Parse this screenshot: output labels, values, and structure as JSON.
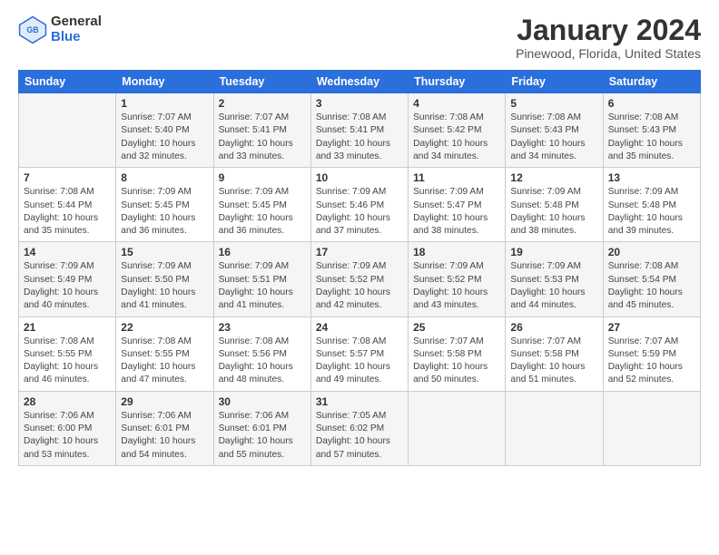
{
  "header": {
    "logo": {
      "general": "General",
      "blue": "Blue"
    },
    "title": "January 2024",
    "location": "Pinewood, Florida, United States"
  },
  "days_of_week": [
    "Sunday",
    "Monday",
    "Tuesday",
    "Wednesday",
    "Thursday",
    "Friday",
    "Saturday"
  ],
  "weeks": [
    [
      {
        "num": "",
        "data": ""
      },
      {
        "num": "1",
        "data": "Sunrise: 7:07 AM\nSunset: 5:40 PM\nDaylight: 10 hours\nand 32 minutes."
      },
      {
        "num": "2",
        "data": "Sunrise: 7:07 AM\nSunset: 5:41 PM\nDaylight: 10 hours\nand 33 minutes."
      },
      {
        "num": "3",
        "data": "Sunrise: 7:08 AM\nSunset: 5:41 PM\nDaylight: 10 hours\nand 33 minutes."
      },
      {
        "num": "4",
        "data": "Sunrise: 7:08 AM\nSunset: 5:42 PM\nDaylight: 10 hours\nand 34 minutes."
      },
      {
        "num": "5",
        "data": "Sunrise: 7:08 AM\nSunset: 5:43 PM\nDaylight: 10 hours\nand 34 minutes."
      },
      {
        "num": "6",
        "data": "Sunrise: 7:08 AM\nSunset: 5:43 PM\nDaylight: 10 hours\nand 35 minutes."
      }
    ],
    [
      {
        "num": "7",
        "data": "Sunrise: 7:08 AM\nSunset: 5:44 PM\nDaylight: 10 hours\nand 35 minutes."
      },
      {
        "num": "8",
        "data": "Sunrise: 7:09 AM\nSunset: 5:45 PM\nDaylight: 10 hours\nand 36 minutes."
      },
      {
        "num": "9",
        "data": "Sunrise: 7:09 AM\nSunset: 5:45 PM\nDaylight: 10 hours\nand 36 minutes."
      },
      {
        "num": "10",
        "data": "Sunrise: 7:09 AM\nSunset: 5:46 PM\nDaylight: 10 hours\nand 37 minutes."
      },
      {
        "num": "11",
        "data": "Sunrise: 7:09 AM\nSunset: 5:47 PM\nDaylight: 10 hours\nand 38 minutes."
      },
      {
        "num": "12",
        "data": "Sunrise: 7:09 AM\nSunset: 5:48 PM\nDaylight: 10 hours\nand 38 minutes."
      },
      {
        "num": "13",
        "data": "Sunrise: 7:09 AM\nSunset: 5:48 PM\nDaylight: 10 hours\nand 39 minutes."
      }
    ],
    [
      {
        "num": "14",
        "data": "Sunrise: 7:09 AM\nSunset: 5:49 PM\nDaylight: 10 hours\nand 40 minutes."
      },
      {
        "num": "15",
        "data": "Sunrise: 7:09 AM\nSunset: 5:50 PM\nDaylight: 10 hours\nand 41 minutes."
      },
      {
        "num": "16",
        "data": "Sunrise: 7:09 AM\nSunset: 5:51 PM\nDaylight: 10 hours\nand 41 minutes."
      },
      {
        "num": "17",
        "data": "Sunrise: 7:09 AM\nSunset: 5:52 PM\nDaylight: 10 hours\nand 42 minutes."
      },
      {
        "num": "18",
        "data": "Sunrise: 7:09 AM\nSunset: 5:52 PM\nDaylight: 10 hours\nand 43 minutes."
      },
      {
        "num": "19",
        "data": "Sunrise: 7:09 AM\nSunset: 5:53 PM\nDaylight: 10 hours\nand 44 minutes."
      },
      {
        "num": "20",
        "data": "Sunrise: 7:08 AM\nSunset: 5:54 PM\nDaylight: 10 hours\nand 45 minutes."
      }
    ],
    [
      {
        "num": "21",
        "data": "Sunrise: 7:08 AM\nSunset: 5:55 PM\nDaylight: 10 hours\nand 46 minutes."
      },
      {
        "num": "22",
        "data": "Sunrise: 7:08 AM\nSunset: 5:55 PM\nDaylight: 10 hours\nand 47 minutes."
      },
      {
        "num": "23",
        "data": "Sunrise: 7:08 AM\nSunset: 5:56 PM\nDaylight: 10 hours\nand 48 minutes."
      },
      {
        "num": "24",
        "data": "Sunrise: 7:08 AM\nSunset: 5:57 PM\nDaylight: 10 hours\nand 49 minutes."
      },
      {
        "num": "25",
        "data": "Sunrise: 7:07 AM\nSunset: 5:58 PM\nDaylight: 10 hours\nand 50 minutes."
      },
      {
        "num": "26",
        "data": "Sunrise: 7:07 AM\nSunset: 5:58 PM\nDaylight: 10 hours\nand 51 minutes."
      },
      {
        "num": "27",
        "data": "Sunrise: 7:07 AM\nSunset: 5:59 PM\nDaylight: 10 hours\nand 52 minutes."
      }
    ],
    [
      {
        "num": "28",
        "data": "Sunrise: 7:06 AM\nSunset: 6:00 PM\nDaylight: 10 hours\nand 53 minutes."
      },
      {
        "num": "29",
        "data": "Sunrise: 7:06 AM\nSunset: 6:01 PM\nDaylight: 10 hours\nand 54 minutes."
      },
      {
        "num": "30",
        "data": "Sunrise: 7:06 AM\nSunset: 6:01 PM\nDaylight: 10 hours\nand 55 minutes."
      },
      {
        "num": "31",
        "data": "Sunrise: 7:05 AM\nSunset: 6:02 PM\nDaylight: 10 hours\nand 57 minutes."
      },
      {
        "num": "",
        "data": ""
      },
      {
        "num": "",
        "data": ""
      },
      {
        "num": "",
        "data": ""
      }
    ]
  ]
}
